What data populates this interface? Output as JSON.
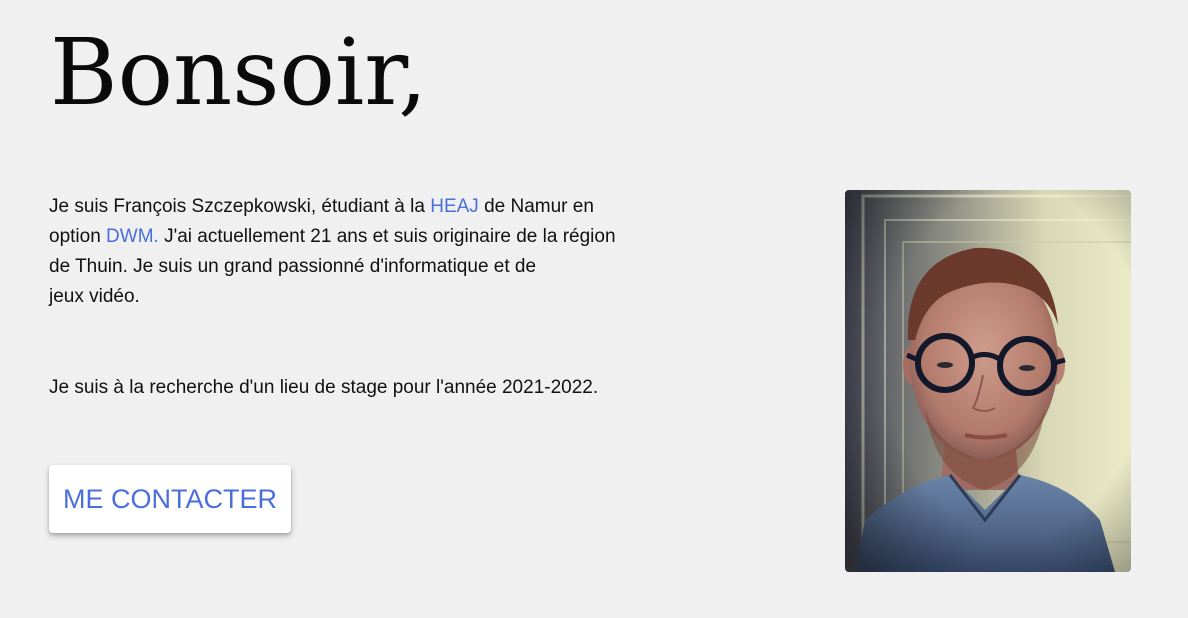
{
  "header": {
    "greeting": "Bonsoir,"
  },
  "intro": {
    "line1_prefix": "Je suis François Szczepkowski, étudiant à la ",
    "school_link": "HEAJ",
    "line1_suffix": " de Namur en",
    "line2_prefix": "option ",
    "option_link": "DWM.",
    "line2_suffix": " J'ai actuellement 21 ans et suis originaire de la région",
    "line3": "de Thuin. Je suis un grand passionné d'informatique et de",
    "line4": "jeux vidéo."
  },
  "internship": {
    "text": "Je suis à la recherche d'un lieu de stage pour l'année 2021-2022."
  },
  "contact": {
    "button_label": "ME CONTACTER"
  },
  "photo": {
    "subject": "portrait-photo"
  },
  "colors": {
    "background": "#f0f0f0",
    "link": "#4a6fdc",
    "text": "#111111"
  }
}
